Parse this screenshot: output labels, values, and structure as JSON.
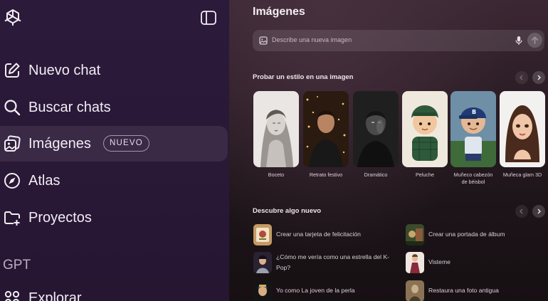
{
  "sidebar": {
    "nav": [
      {
        "label": "Nuevo chat",
        "icon": "new-chat-icon"
      },
      {
        "label": "Buscar chats",
        "icon": "search-icon"
      },
      {
        "label": "Imágenes",
        "icon": "images-icon",
        "badge": "NUEVO"
      },
      {
        "label": "Atlas",
        "icon": "atlas-icon"
      },
      {
        "label": "Proyectos",
        "icon": "folder-plus-icon"
      }
    ],
    "section_title": "GPT",
    "explore_label": "Explorar"
  },
  "main": {
    "title": "Imágenes",
    "prompt_placeholder": "Describe una nueva imagen",
    "styles_title": "Probar un estilo en una imagen",
    "styles": [
      "Boceto",
      "Retrato festivo",
      "Dramático",
      "Peluche",
      "Muñeco cabezón de béisbol",
      "Muñeca glam 3D"
    ],
    "discover_title": "Descubre algo nuevo",
    "discover": [
      "Crear una tarjeta de felicitación",
      "Crear una portada de álbum",
      "¿Cómo me vería como una estrella del K-Pop?",
      "Visteme",
      "Yo como La joven de la perla",
      "Restaura una foto antigua"
    ]
  },
  "colors": {
    "sidebar_bg": "#2a1837",
    "main_bg": "#2a1c24",
    "active_item": "rgba(255,255,255,0.08)"
  }
}
